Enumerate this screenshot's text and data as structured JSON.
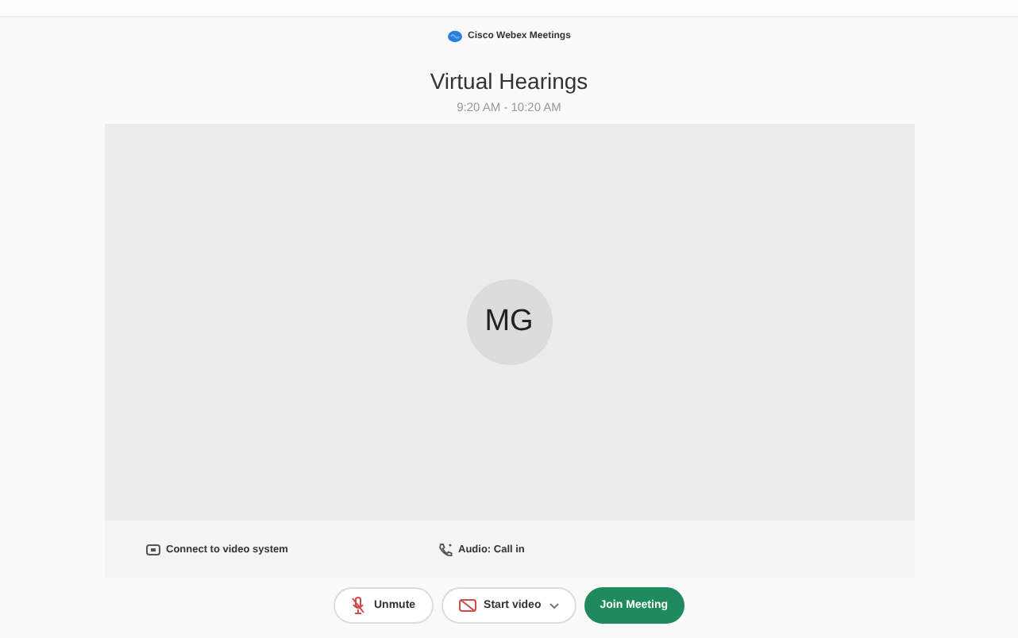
{
  "app": {
    "name": "Cisco Webex Meetings"
  },
  "meeting": {
    "title": "Virtual Hearings",
    "time": "9:20 AM - 10:20 AM"
  },
  "preview": {
    "avatar_initials": "MG"
  },
  "options": [
    {
      "kind": "video-system",
      "label": "Connect to video system"
    },
    {
      "kind": "audio",
      "label": "Audio: Call in"
    }
  ],
  "controls": [
    {
      "kind": "mute",
      "label": "Unmute",
      "muted": true
    },
    {
      "kind": "video",
      "label": "Start video",
      "video_off": true
    },
    {
      "kind": "join",
      "label": "Join Meeting"
    }
  ]
}
